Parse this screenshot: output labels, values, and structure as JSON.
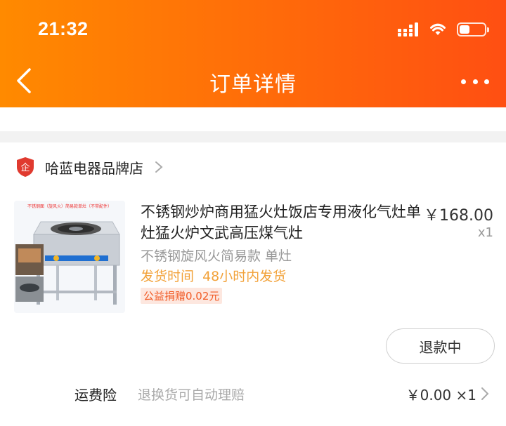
{
  "status_bar": {
    "time": "21:32",
    "battery_level": 0.4
  },
  "nav": {
    "title": "订单详情"
  },
  "shop": {
    "name": "哈蓝电器品牌店",
    "badge_text": "企"
  },
  "product": {
    "title": "不锈钢炒炉商用猛火灶饭店专用液化气灶单灶猛火炉文武高压煤气灶",
    "price": "￥168.00",
    "quantity": "x1",
    "sku": "不锈钢旋风火简易款 单灶",
    "shipping": "发货时间  48小时内发货",
    "charity": "公益捐赠0.02元",
    "image_banner": "不锈钢面（旋风火）简易款单灶（不带配件）"
  },
  "actions": {
    "refund_label": "退款中"
  },
  "insurance": {
    "label": "运费险",
    "description": "退换货可自动理赔",
    "value": "￥0.00 ×1"
  },
  "colors": {
    "accent": "#ff6a0a",
    "shipping": "#f2a23a",
    "charity": "#f15a24"
  }
}
